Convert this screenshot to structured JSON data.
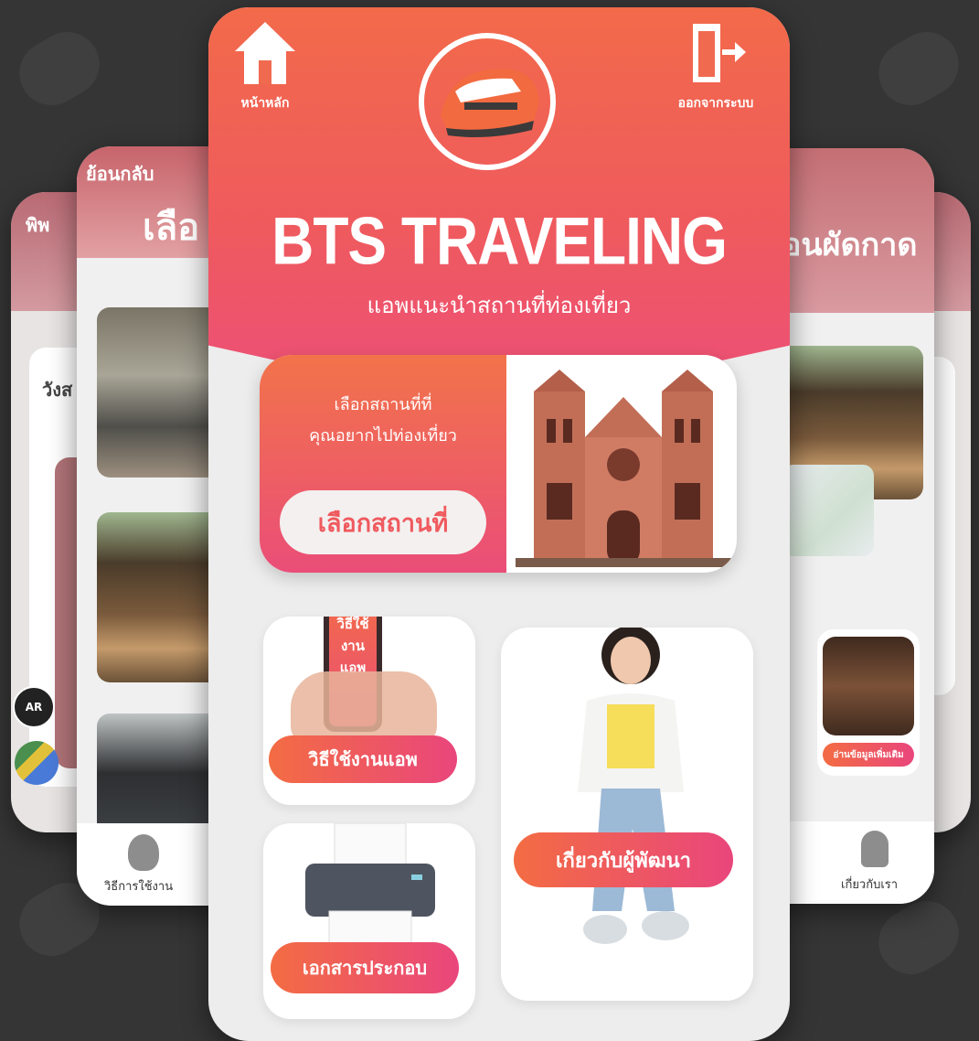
{
  "back_cards": {
    "far_left": {
      "back_label": "พิพ",
      "city_label": "วังส"
    },
    "mid_left": {
      "back_label": "ย้อนกลับ",
      "title_partial": "เลือ",
      "nav_label": "วิธีการใช้งาน"
    },
    "mid_right": {
      "title_partial": "อนผัดกาด",
      "more_info_label": "อ่านข้อมูลเพิ่มเติม",
      "nav_label": "เกี่ยวกับเรา"
    }
  },
  "header": {
    "home_label": "หน้าหลัก",
    "logout_label": "ออกจากระบบ"
  },
  "app": {
    "title": "BTS TRAVELING",
    "subtitle": "แอพแนะนำสถานที่ท่องเที่ยว"
  },
  "select_place": {
    "prompt_line1": "เลือกสถานที่ที่",
    "prompt_line2": "คุณอยากไปท่องเที่ยว",
    "button_label": "เลือกสถานที่"
  },
  "menu": {
    "how_to_phone_text": [
      "วิธีใช้",
      "งาน",
      "แอพ"
    ],
    "how_to_label": "วิธีใช้งานแอพ",
    "documents_label": "เอกสารประกอบ",
    "developers_label": "เกี่ยวกับผู้พัฒนา"
  },
  "ar_badge": "AR",
  "colors": {
    "primary_orange": "#f26a4a",
    "primary_pink": "#ea4e78",
    "background": "#353535"
  }
}
